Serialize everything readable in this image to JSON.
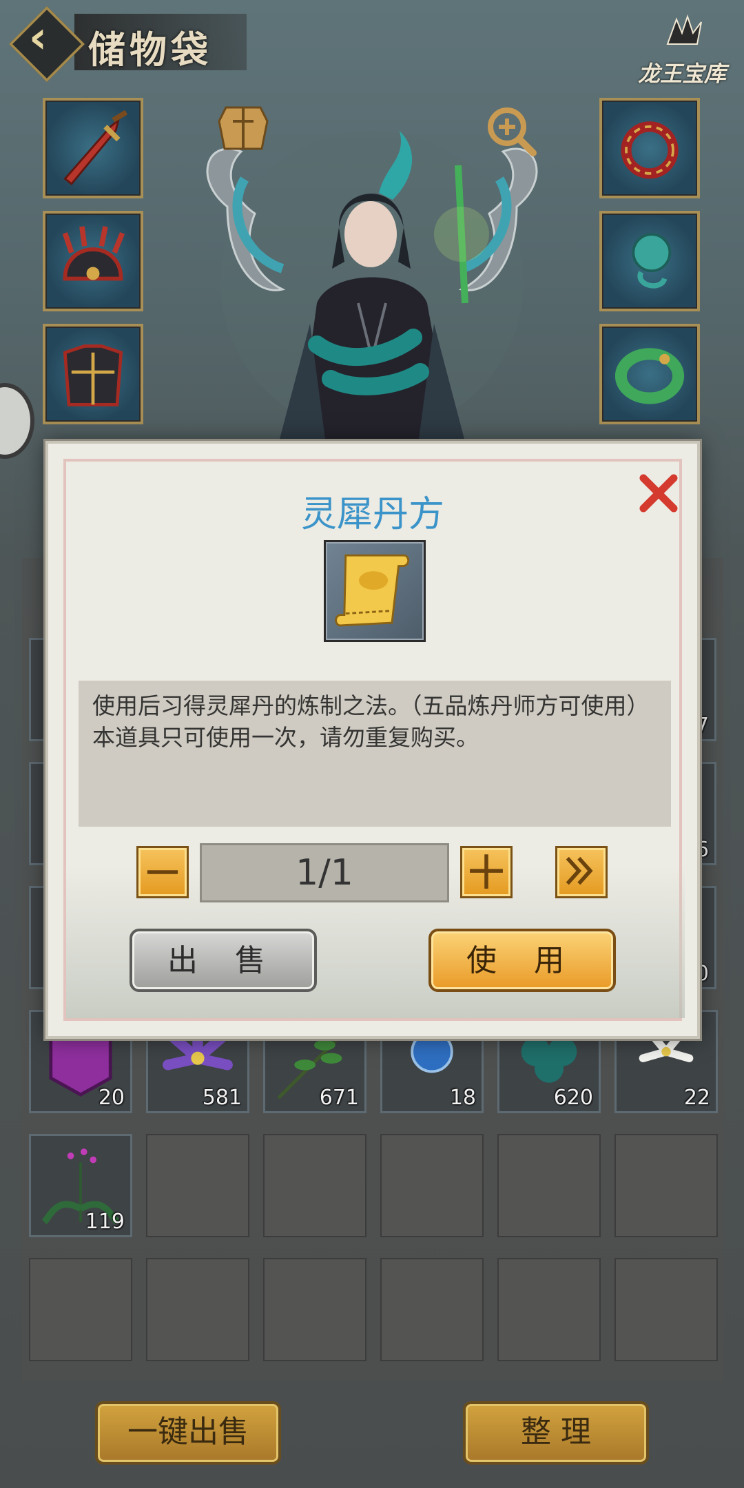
{
  "header": {
    "title": "储物袋",
    "logo_text": "龙王宝库"
  },
  "equipment": {
    "left_slots": [
      "sword-icon",
      "helmet-icon",
      "armor-icon"
    ],
    "right_slots": [
      "ring-icon",
      "jade-pendant-icon",
      "jade-bracelet-icon"
    ]
  },
  "inventory": {
    "visible_items": [
      {
        "icon": "purple-seal-icon",
        "count": "20"
      },
      {
        "icon": "purple-flower-icon",
        "count": "581"
      },
      {
        "icon": "green-herb-icon",
        "count": "671"
      },
      {
        "icon": "blue-orb-icon",
        "count": "18"
      },
      {
        "icon": "teal-leaf-icon",
        "count": "620"
      },
      {
        "icon": "white-lily-icon",
        "count": "22"
      },
      {
        "icon": "pink-orchid-icon",
        "count": "119"
      }
    ],
    "partially_hidden_counts": [
      "7",
      "6",
      "0"
    ]
  },
  "bottom_bar": {
    "sell_all_label": "一键出售",
    "sort_label": "整 理"
  },
  "modal": {
    "title": "灵犀丹方",
    "description": "使用后习得灵犀丹的炼制之法。（五品炼丹师方可使用）本道具只可使用一次，请勿重复购买。",
    "quantity": "1/1",
    "sell_label": "出 售",
    "use_label": "使 用",
    "title_color": "#3a93c9"
  }
}
